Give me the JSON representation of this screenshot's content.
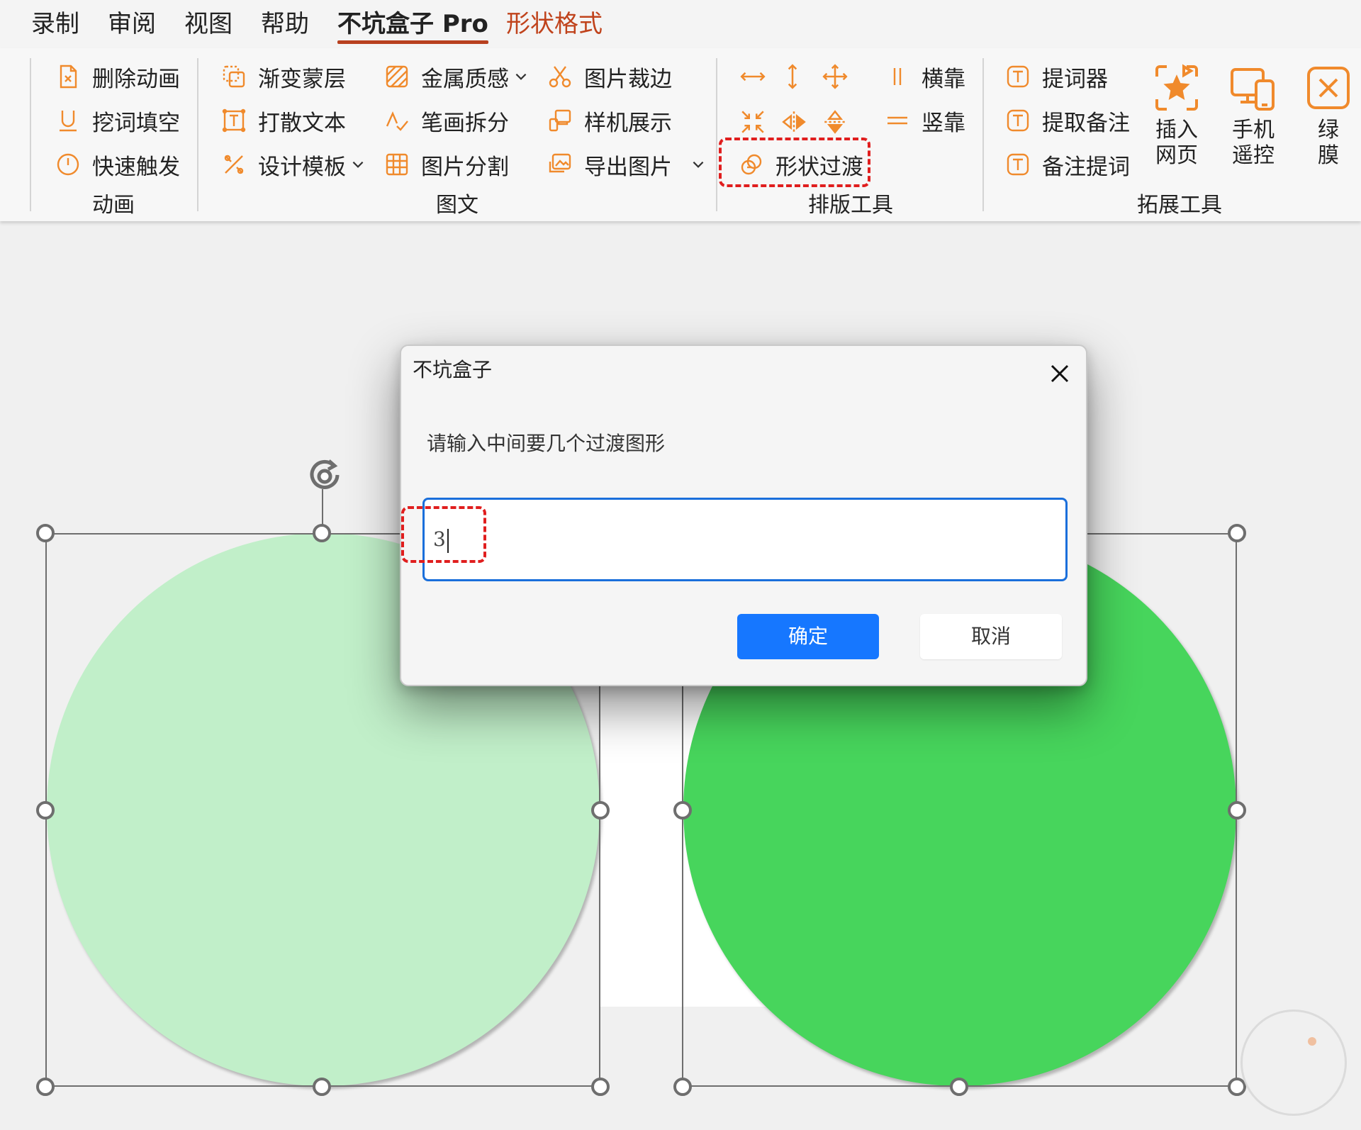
{
  "tabs": [
    {
      "label": "录制"
    },
    {
      "label": "审阅"
    },
    {
      "label": "视图"
    },
    {
      "label": "帮助"
    },
    {
      "label": "不坑盒子 Pro"
    },
    {
      "label": "形状格式"
    }
  ],
  "groups": {
    "animation": {
      "label": "动画",
      "items": [
        "删除动画",
        "挖词填空",
        "快速触发"
      ]
    },
    "graphics": {
      "label": "图文",
      "items": [
        "渐变蒙层",
        "打散文本",
        "设计模板",
        "金属质感",
        "笔画拆分",
        "图片分割",
        "图片裁边",
        "样机展示",
        "导出图片"
      ]
    },
    "layout": {
      "label": "排版工具",
      "items": [
        "横靠",
        "竖靠",
        "形状过渡"
      ]
    },
    "extend": {
      "label": "拓展工具",
      "items": [
        "提词器",
        "提取备注",
        "备注提词"
      ],
      "big": [
        {
          "line1": "插入",
          "line2": "网页"
        },
        {
          "line1": "手机",
          "line2": "遥控"
        },
        {
          "line1": "绿",
          "line2": "膜"
        }
      ]
    }
  },
  "colors": {
    "accent_orange": "#f08a2c",
    "highlight_red": "#e01e1e",
    "circle_light": "#c1efc9",
    "circle_dark": "#47d55c",
    "primary_blue": "#1677ff"
  },
  "dialog": {
    "title": "不坑盒子",
    "prompt": "请输入中间要几个过渡图形",
    "input_value": "3",
    "ok_label": "确定",
    "cancel_label": "取消"
  }
}
